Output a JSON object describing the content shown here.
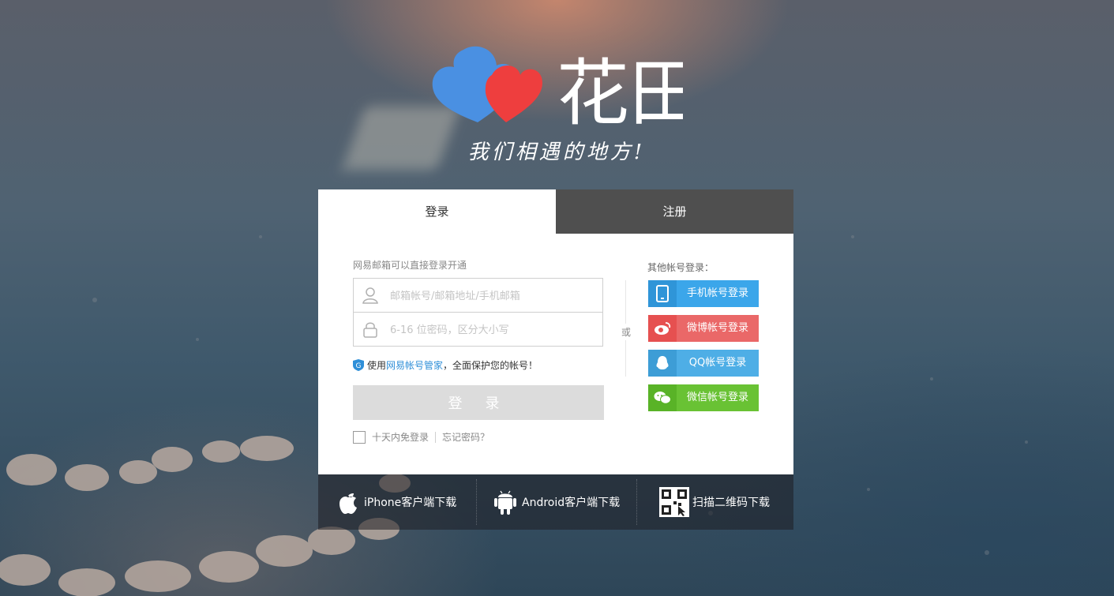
{
  "brand": {
    "name": "花田",
    "slogan": "我们相遇的地方!",
    "colors": {
      "blue_heart": "#4a90e2",
      "red_heart": "#ee3e3e"
    }
  },
  "tabs": [
    {
      "label": "登录",
      "active": true
    },
    {
      "label": "注册",
      "active": false
    }
  ],
  "login": {
    "hint": "网易邮箱可以直接登录开通",
    "username_placeholder": "邮箱帐号/邮箱地址/手机邮箱",
    "password_placeholder": "6-16 位密码，区分大小写",
    "guard_prefix": "使用",
    "guard_link": "网易帐号管家",
    "guard_suffix": "，全面保护您的帐号！",
    "submit_label": "登 录",
    "remember_label": "十天内免登录",
    "forgot_label": "忘记密码？",
    "or_label": "或"
  },
  "other_login": {
    "title": "其他帐号登录：",
    "buttons": [
      {
        "label": "手机帐号登录",
        "icon": "phone-icon",
        "color": "#3ba6ea"
      },
      {
        "label": "微博帐号登录",
        "icon": "weibo-icon",
        "color": "#ea6868"
      },
      {
        "label": "QQ帐号登录",
        "icon": "qq-icon",
        "color": "#4eaee6"
      },
      {
        "label": "微信帐号登录",
        "icon": "wechat-icon",
        "color": "#69c234"
      }
    ]
  },
  "downloads": [
    {
      "label": "iPhone客户端下载",
      "icon": "apple-icon"
    },
    {
      "label": "Android客户端下载",
      "icon": "android-icon"
    },
    {
      "label": "扫描二维码下载",
      "icon": "qrcode-icon"
    }
  ]
}
